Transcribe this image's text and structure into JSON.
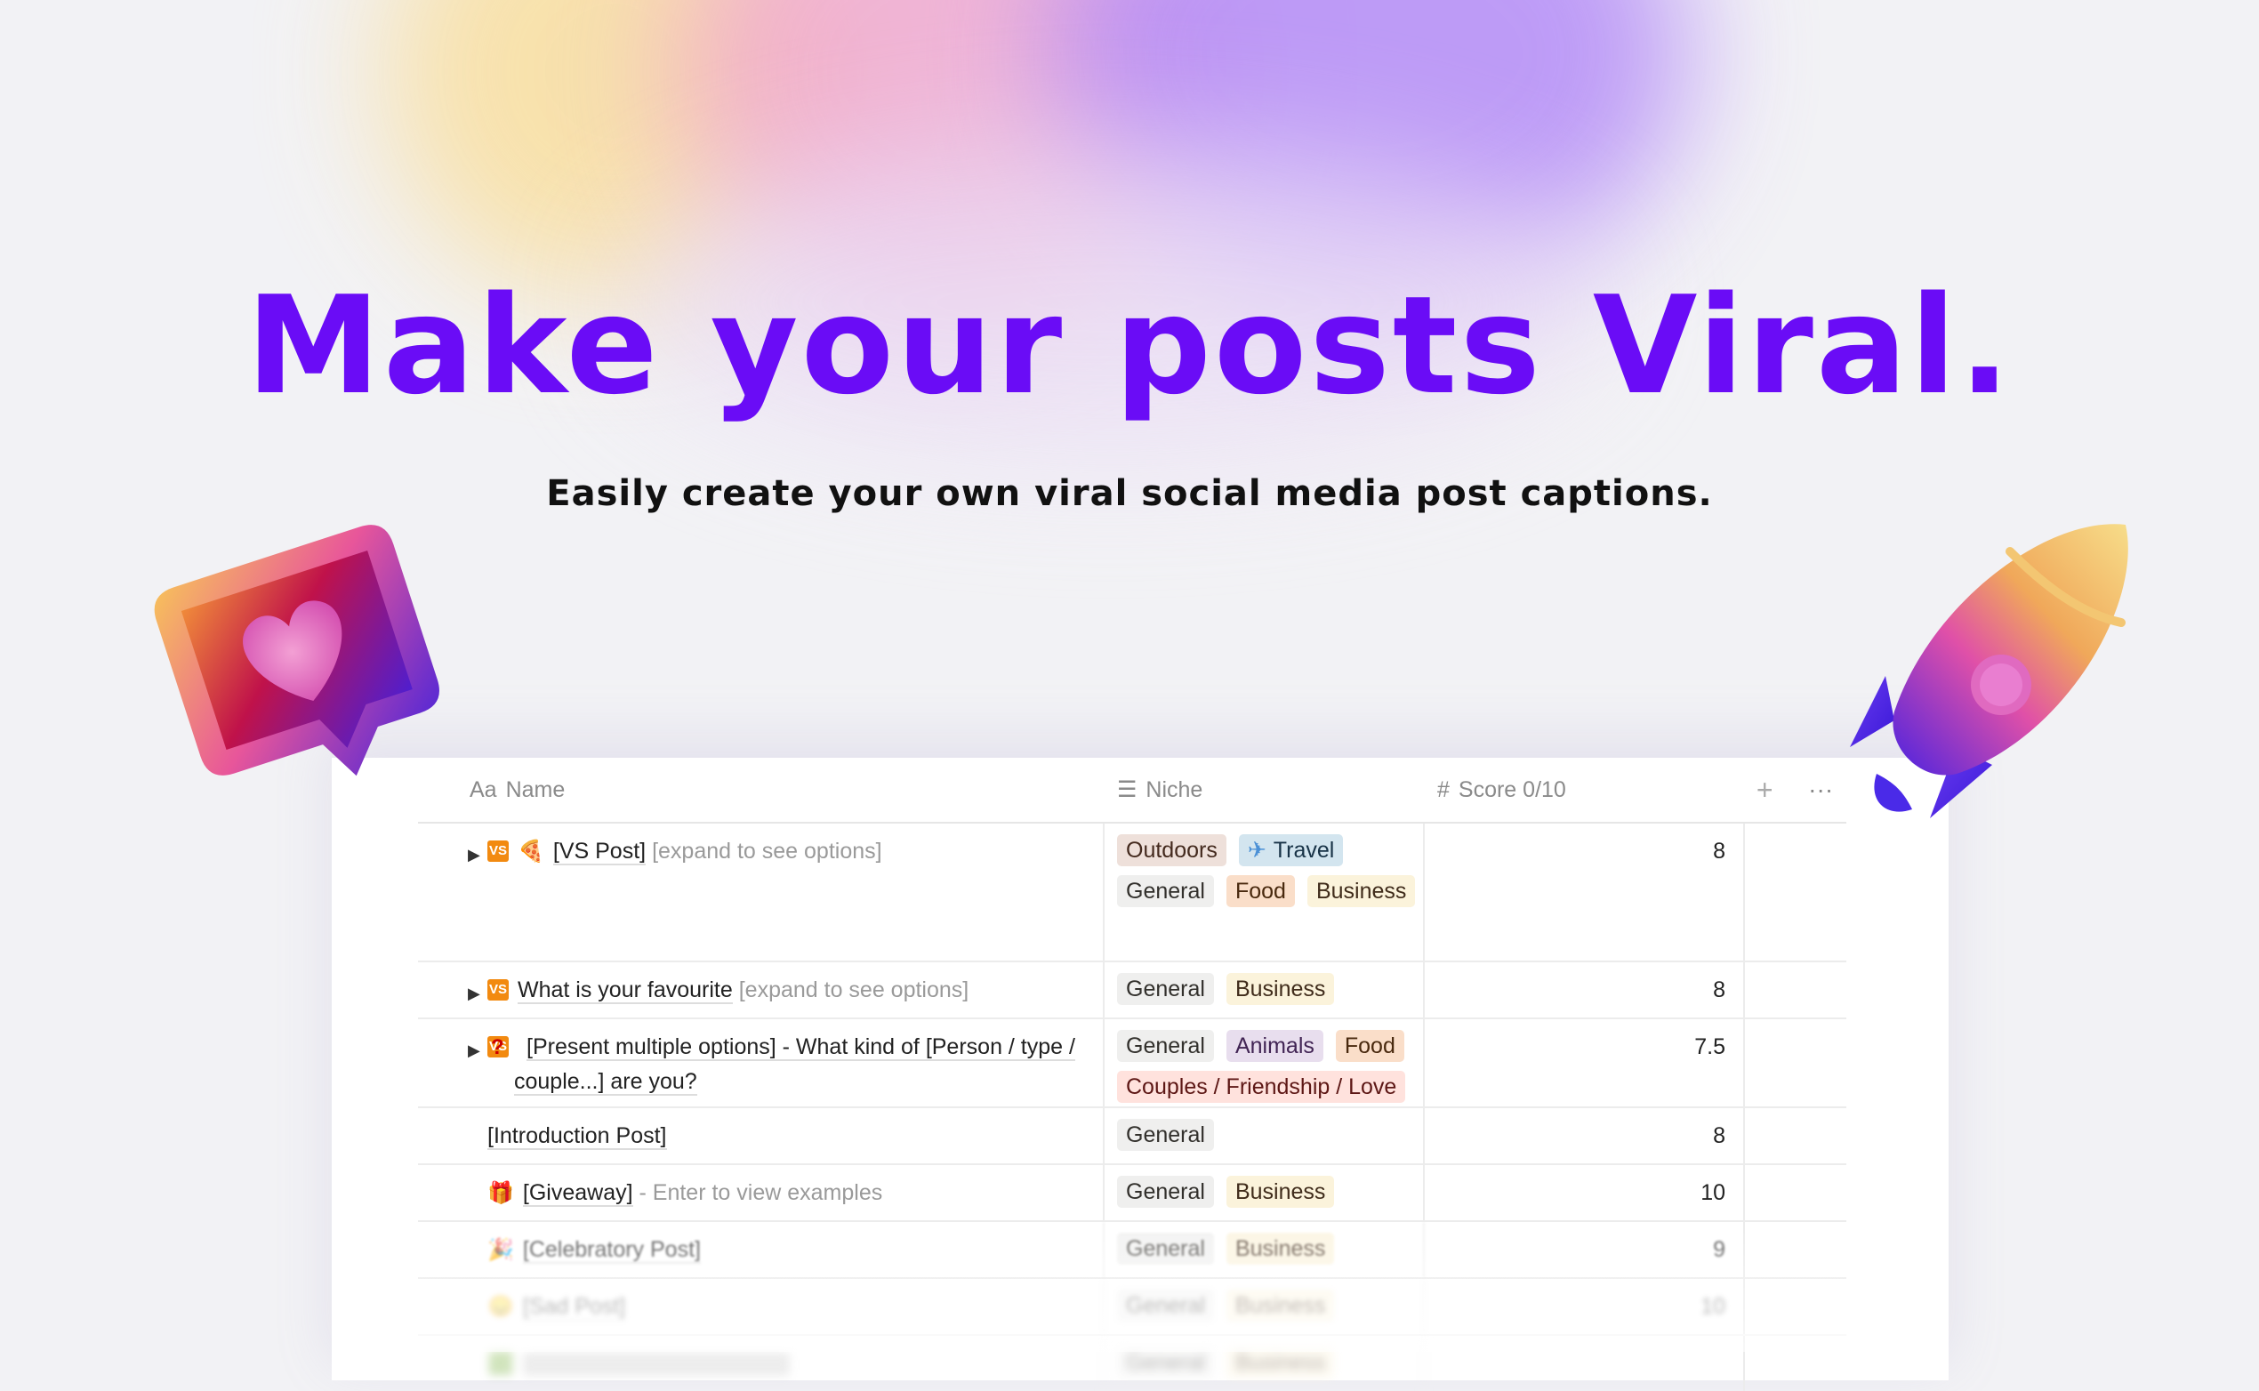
{
  "hero": {
    "title": "Make your posts Viral.",
    "subtitle": "Easily create your own viral social media post captions."
  },
  "colors": {
    "title": "#6a0cf6",
    "background": "#f2f2f5"
  },
  "decorations": {
    "left": "heart-like-bubble-3d",
    "right": "rocket-3d"
  },
  "table": {
    "columns": [
      {
        "icon": "Aa",
        "label": "Name"
      },
      {
        "icon": "list-icon",
        "label": "Niche"
      },
      {
        "icon": "#",
        "label": "Score 0/10"
      }
    ],
    "add_label": "+",
    "more_label": "···",
    "rows": [
      {
        "toggle": "▶",
        "badge": "VS",
        "emoji": "🍕",
        "title": "[VS Post]",
        "hint": "[expand to see options]",
        "tags": [
          "Outdoors",
          "Travel",
          "General",
          "Food",
          "Business"
        ],
        "score": "8"
      },
      {
        "toggle": "▶",
        "badge": "VS",
        "title": "What is your favourite",
        "hint": "[expand to see options]",
        "tags": [
          "General",
          "Business"
        ],
        "score": "8"
      },
      {
        "toggle": "▶",
        "badge": "VS",
        "emoji": "?",
        "title": "[Present multiple options] - What kind of [Person / type / couple...] are you?",
        "tags": [
          "General",
          "Animals",
          "Food",
          "Couples / Friendship / Love"
        ],
        "score": "7.5"
      },
      {
        "title": "[Introduction Post]",
        "tags": [
          "General"
        ],
        "score": "8"
      },
      {
        "emoji": "🎁",
        "title": "[Giveaway]",
        "hint": "- Enter to view examples",
        "tags": [
          "General",
          "Business"
        ],
        "score": "10"
      },
      {
        "emoji": "🎉",
        "title": "[Celebratory Post]",
        "tags": [
          "General",
          "Business"
        ],
        "score": "9"
      },
      {
        "emoji": "😞",
        "title": "[Sad Post]",
        "tags": [
          "General",
          "Business"
        ],
        "score": "10"
      },
      {
        "emoji": "🟩",
        "title": "",
        "tags": [
          "General",
          "Business"
        ],
        "score": ""
      }
    ]
  },
  "travel_icon": "✈"
}
